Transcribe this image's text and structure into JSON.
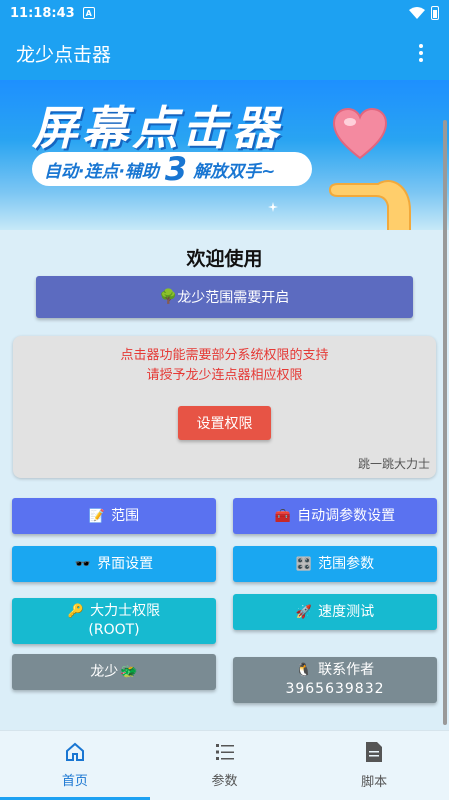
{
  "status_bar": {
    "time": "11:18:43",
    "notif_letter": "A"
  },
  "app_bar": {
    "title": "龙少点击器"
  },
  "banner": {
    "title": "屏幕点击器",
    "pill_left": "自动·连点·辅助",
    "pill_num": "3",
    "pill_right": "解放双手~"
  },
  "welcome": "欢迎使用",
  "range_notice": {
    "icon": "🌳",
    "label": "龙少范围需要开启"
  },
  "permission": {
    "line1": "点击器功能需要部分系统权限的支持",
    "line2": "请授予龙少连点器相应权限",
    "button": "设置权限",
    "author": "跳一跳大力士"
  },
  "buttons": {
    "range": {
      "icon": "📝",
      "label": "范围"
    },
    "auto_params": {
      "icon": "🧰",
      "label": "自动调参数设置"
    },
    "ui_settings": {
      "icon": "🕶️",
      "label": "界面设置"
    },
    "range_params": {
      "icon": "🎛️",
      "label": "范围参数"
    },
    "root": {
      "icon": "🔑",
      "line1": "大力士权限",
      "line2": "(ROOT)"
    },
    "speed_test": {
      "icon": "🚀",
      "label": "速度测试"
    },
    "longshao": {
      "label": "龙少",
      "icon": "🐲"
    },
    "contact": {
      "icon": "🐧",
      "line1": "联系作者",
      "line2": "3965639832"
    }
  },
  "bottom_nav": [
    {
      "label": "首页",
      "icon": "home-icon",
      "active": true
    },
    {
      "label": "参数",
      "icon": "list-icon",
      "active": false
    },
    {
      "label": "脚本",
      "icon": "document-icon",
      "active": false
    }
  ],
  "colors": {
    "primary": "#1da1f2",
    "indigo": "#5a72f0",
    "sky": "#1aa7f1",
    "cyan": "#17bad0",
    "grey": "#7a8b93",
    "warning_text": "#e53935",
    "permission_button": "#e75445"
  }
}
